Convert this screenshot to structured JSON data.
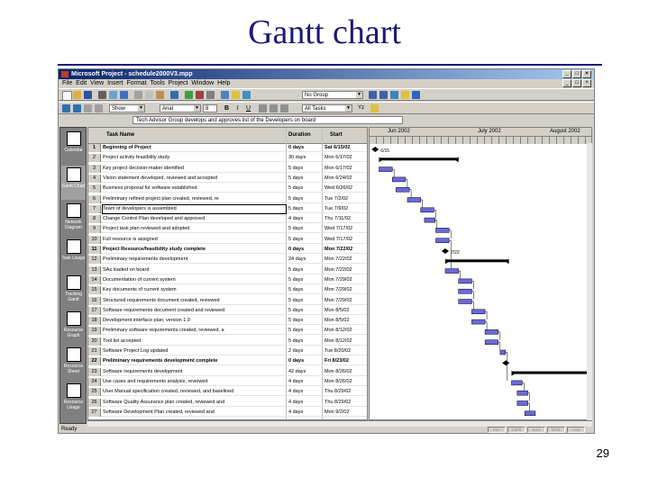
{
  "slide": {
    "title": "Gantt chart",
    "page_number": "29"
  },
  "window": {
    "title": "Microsoft Project - schedule2000V3.mpp"
  },
  "menu": {
    "items": [
      "File",
      "Edit",
      "View",
      "Insert",
      "Format",
      "Tools",
      "Project",
      "Window",
      "Help"
    ]
  },
  "toolbar": {
    "group_combo": "No Group",
    "filter_combo": "All Tasks",
    "zoom_label": "Arial"
  },
  "entry_bar": {
    "value": "Tech Advisor Group develops and approves list of the Developers on board"
  },
  "view_bar": {
    "items": [
      {
        "label": "Calendar",
        "icon": "calendar-icon"
      },
      {
        "label": "Gantt Chart",
        "icon": "gantt-icon",
        "active": true
      },
      {
        "label": "Network Diagram",
        "icon": "network-diagram-icon"
      },
      {
        "label": "Task Usage",
        "icon": "task-usage-icon"
      },
      {
        "label": "Tracking Gantt",
        "icon": "tracking-gantt-icon"
      },
      {
        "label": "Resource Graph",
        "icon": "resource-graph-icon"
      },
      {
        "label": "Resource Sheet",
        "icon": "resource-sheet-icon"
      },
      {
        "label": "Resource Usage",
        "icon": "resource-usage-icon"
      }
    ]
  },
  "table": {
    "columns": {
      "id": "",
      "task": "Task Name",
      "duration": "Duration",
      "start": "Start"
    },
    "rows": [
      {
        "id": "1",
        "task": "Beginning of Project",
        "duration": "0 days",
        "start": "Sat 6/15/02",
        "bold": true
      },
      {
        "id": "2",
        "task": "Project activity feasibility study",
        "duration": "30 days",
        "start": "Mon 6/17/02"
      },
      {
        "id": "3",
        "task": "Key project decision-maker identified",
        "duration": "5 days",
        "start": "Mon 6/17/02"
      },
      {
        "id": "4",
        "task": "Vision statement developed, reviewed and accepted",
        "duration": "5 days",
        "start": "Mon 6/24/02"
      },
      {
        "id": "5",
        "task": "Business proposal for software established",
        "duration": "5 days",
        "start": "Wed 6/26/02"
      },
      {
        "id": "6",
        "task": "Preliminary refined project plan created, reviewed, re",
        "duration": "5 days",
        "start": "Tue 7/2/02"
      },
      {
        "id": "7",
        "task": "Team of developers is assembled",
        "duration": "5 days",
        "start": "Tue 7/9/02",
        "selected": true
      },
      {
        "id": "8",
        "task": "Change Control Plan developed and approved",
        "duration": "4 days",
        "start": "Thu 7/11/02"
      },
      {
        "id": "9",
        "task": "Project task plan reviewed and adopted",
        "duration": "5 days",
        "start": "Wed 7/17/02"
      },
      {
        "id": "10",
        "task": "Full resource is assigned",
        "duration": "5 days",
        "start": "Wed 7/17/02"
      },
      {
        "id": "11",
        "task": "Project Resource/feasibility study complete",
        "duration": "0 days",
        "start": "Mon 7/22/02",
        "bold": true
      },
      {
        "id": "12",
        "task": "Preliminary requirements development",
        "duration": "24 days",
        "start": "Mon 7/22/02"
      },
      {
        "id": "13",
        "task": "SAs loaded on board",
        "duration": "5 days",
        "start": "Mon 7/22/02"
      },
      {
        "id": "14",
        "task": "Documentation of current system",
        "duration": "5 days",
        "start": "Mon 7/29/02"
      },
      {
        "id": "15",
        "task": "Key documents of current system",
        "duration": "5 days",
        "start": "Mon 7/29/02"
      },
      {
        "id": "16",
        "task": "Structured requirements document created, reviewed",
        "duration": "5 days",
        "start": "Mon 7/29/02"
      },
      {
        "id": "17",
        "task": "Software requirements document created and reviewed",
        "duration": "5 days",
        "start": "Mon 8/5/02"
      },
      {
        "id": "18",
        "task": "Development interface plan, version 1.0",
        "duration": "5 days",
        "start": "Mon 8/5/02"
      },
      {
        "id": "19",
        "task": "Preliminary software requirements created, reviewed, a",
        "duration": "5 days",
        "start": "Mon 8/12/02"
      },
      {
        "id": "20",
        "task": "Tool list accepted",
        "duration": "5 days",
        "start": "Mon 8/12/02"
      },
      {
        "id": "21",
        "task": "Software Project Log updated",
        "duration": "2 days",
        "start": "Tue 8/20/02"
      },
      {
        "id": "22",
        "task": "Preliminary requirements development complete",
        "duration": "0 days",
        "start": "Fri 8/23/02",
        "bold": true
      },
      {
        "id": "23",
        "task": "Software requirements development",
        "duration": "42 days",
        "start": "Mon 8/26/02"
      },
      {
        "id": "24",
        "task": "Use cases and requirements analysis, reviewed",
        "duration": "4 days",
        "start": "Mon 8/26/02"
      },
      {
        "id": "25",
        "task": "User Manual specification created, reviewed, and baselined",
        "duration": "4 days",
        "start": "Thu 8/29/02"
      },
      {
        "id": "26",
        "task": "Software Quality Assurance plan created, reviewed and",
        "duration": "4 days",
        "start": "Thu 8/29/02"
      },
      {
        "id": "27",
        "task": "Software Development Plan created, reviewed and",
        "duration": "4 days",
        "start": "Mon 9/2/02"
      }
    ]
  },
  "timescale": {
    "months": [
      "Jun 2002",
      "July 2002",
      "August 2002"
    ],
    "milestone_labels": [
      "6/15",
      "7/22"
    ]
  },
  "status_bar": {
    "text": "Ready",
    "indicators": [
      "EXT",
      "CAPS",
      "NUM",
      "SCRL",
      "OVR"
    ]
  }
}
